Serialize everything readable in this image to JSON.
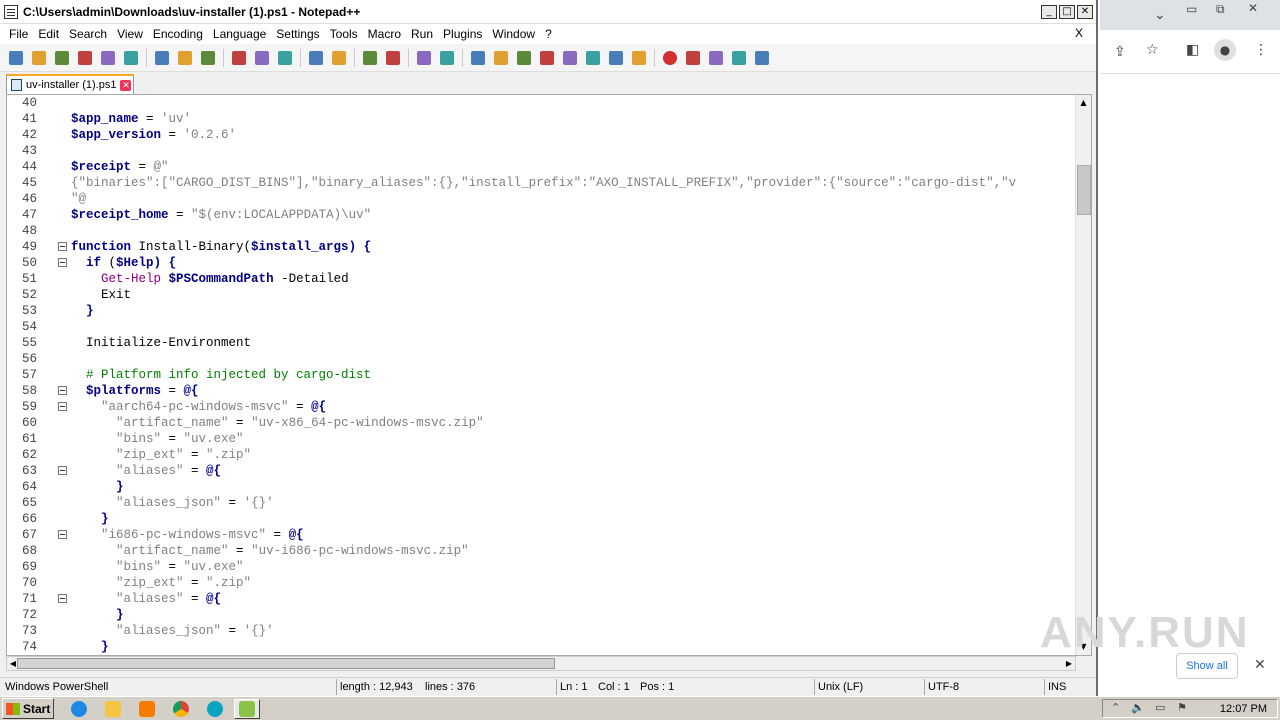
{
  "window": {
    "title": "C:\\Users\\admin\\Downloads\\uv-installer (1).ps1 - Notepad++"
  },
  "menu": [
    "File",
    "Edit",
    "Search",
    "View",
    "Encoding",
    "Language",
    "Settings",
    "Tools",
    "Macro",
    "Run",
    "Plugins",
    "Window",
    "?"
  ],
  "menu_close": "X",
  "tab": {
    "label": "uv-installer (1).ps1"
  },
  "colors": {
    "keyword": "#00008b",
    "string": "#808080",
    "comment": "#008000",
    "command": "#8b008b"
  },
  "toolbar_icons": [
    "new-icon",
    "open-icon",
    "save-icon",
    "save-all-icon",
    "close-icon",
    "close-all-icon",
    "print-icon",
    "cut-icon",
    "copy-icon",
    "paste-icon",
    "undo-icon",
    "redo-icon",
    "find-icon",
    "replace-icon",
    "zoom-in-icon",
    "zoom-out-icon",
    "sync-v-icon",
    "sync-h-icon",
    "wrap-icon",
    "all-chars-icon",
    "indent-guide-icon",
    "udl-icon",
    "doc-map-icon",
    "function-list-icon",
    "folder-icon",
    "monitor-icon",
    "record-icon",
    "stop-icon",
    "play-icon",
    "play-multi-icon",
    "save-macro-icon"
  ],
  "code_lines": [
    {
      "n": "40",
      "fold": false,
      "seg": []
    },
    {
      "n": "41",
      "fold": false,
      "seg": [
        {
          "t": "$app_name",
          "c": "var"
        },
        {
          "t": " = ",
          "c": ""
        },
        {
          "t": "'uv'",
          "c": "str"
        }
      ]
    },
    {
      "n": "42",
      "fold": false,
      "seg": [
        {
          "t": "$app_version",
          "c": "var"
        },
        {
          "t": " = ",
          "c": ""
        },
        {
          "t": "'0.2.6'",
          "c": "str"
        }
      ]
    },
    {
      "n": "43",
      "fold": false,
      "seg": []
    },
    {
      "n": "44",
      "fold": false,
      "seg": [
        {
          "t": "$receipt",
          "c": "var"
        },
        {
          "t": " = ",
          "c": ""
        },
        {
          "t": "@\"",
          "c": "str"
        }
      ]
    },
    {
      "n": "45",
      "fold": false,
      "seg": [
        {
          "t": "{\"binaries\":[\"CARGO_DIST_BINS\"],\"binary_aliases\":{},\"install_prefix\":\"AXO_INSTALL_PREFIX\",\"provider\":{\"source\":\"cargo-dist\",\"v",
          "c": "str"
        }
      ]
    },
    {
      "n": "46",
      "fold": false,
      "seg": [
        {
          "t": "\"@",
          "c": "str"
        }
      ]
    },
    {
      "n": "47",
      "fold": false,
      "seg": [
        {
          "t": "$receipt_home",
          "c": "var"
        },
        {
          "t": " = ",
          "c": ""
        },
        {
          "t": "\"$(env:LOCALAPPDATA)\\uv\"",
          "c": "str"
        }
      ]
    },
    {
      "n": "48",
      "fold": false,
      "seg": []
    },
    {
      "n": "49",
      "fold": true,
      "seg": [
        {
          "t": "function",
          "c": "kw"
        },
        {
          "t": " Install-Binary(",
          "c": ""
        },
        {
          "t": "$install_args",
          "c": "var"
        },
        {
          "t": ") {",
          "c": "kw"
        }
      ]
    },
    {
      "n": "50",
      "fold": true,
      "seg": [
        {
          "t": "  ",
          "c": ""
        },
        {
          "t": "if",
          "c": "kw"
        },
        {
          "t": " (",
          "c": ""
        },
        {
          "t": "$Help",
          "c": "var"
        },
        {
          "t": ") {",
          "c": "kw"
        }
      ]
    },
    {
      "n": "51",
      "fold": false,
      "seg": [
        {
          "t": "    ",
          "c": ""
        },
        {
          "t": "Get-Help",
          "c": "cmd"
        },
        {
          "t": " ",
          "c": ""
        },
        {
          "t": "$PSCommandPath",
          "c": "var"
        },
        {
          "t": " -Detailed",
          "c": ""
        }
      ]
    },
    {
      "n": "52",
      "fold": false,
      "seg": [
        {
          "t": "    Exit",
          "c": ""
        }
      ]
    },
    {
      "n": "53",
      "fold": false,
      "seg": [
        {
          "t": "  }",
          "c": "kw"
        }
      ]
    },
    {
      "n": "54",
      "fold": false,
      "seg": []
    },
    {
      "n": "55",
      "fold": false,
      "seg": [
        {
          "t": "  Initialize-Environment",
          "c": ""
        }
      ]
    },
    {
      "n": "56",
      "fold": false,
      "seg": []
    },
    {
      "n": "57",
      "fold": false,
      "seg": [
        {
          "t": "  # Platform info injected by cargo-dist",
          "c": "cmt"
        }
      ]
    },
    {
      "n": "58",
      "fold": true,
      "seg": [
        {
          "t": "  ",
          "c": ""
        },
        {
          "t": "$platforms",
          "c": "var"
        },
        {
          "t": " = ",
          "c": ""
        },
        {
          "t": "@{",
          "c": "kw"
        }
      ]
    },
    {
      "n": "59",
      "fold": true,
      "seg": [
        {
          "t": "    ",
          "c": ""
        },
        {
          "t": "\"aarch64-pc-windows-msvc\"",
          "c": "str"
        },
        {
          "t": " = ",
          "c": ""
        },
        {
          "t": "@{",
          "c": "kw"
        }
      ]
    },
    {
      "n": "60",
      "fold": false,
      "seg": [
        {
          "t": "      ",
          "c": ""
        },
        {
          "t": "\"artifact_name\"",
          "c": "str"
        },
        {
          "t": " = ",
          "c": ""
        },
        {
          "t": "\"uv-x86_64-pc-windows-msvc.zip\"",
          "c": "str"
        }
      ]
    },
    {
      "n": "61",
      "fold": false,
      "seg": [
        {
          "t": "      ",
          "c": ""
        },
        {
          "t": "\"bins\"",
          "c": "str"
        },
        {
          "t": " = ",
          "c": ""
        },
        {
          "t": "\"uv.exe\"",
          "c": "str"
        }
      ]
    },
    {
      "n": "62",
      "fold": false,
      "seg": [
        {
          "t": "      ",
          "c": ""
        },
        {
          "t": "\"zip_ext\"",
          "c": "str"
        },
        {
          "t": " = ",
          "c": ""
        },
        {
          "t": "\".zip\"",
          "c": "str"
        }
      ]
    },
    {
      "n": "63",
      "fold": true,
      "seg": [
        {
          "t": "      ",
          "c": ""
        },
        {
          "t": "\"aliases\"",
          "c": "str"
        },
        {
          "t": " = ",
          "c": ""
        },
        {
          "t": "@{",
          "c": "kw"
        }
      ]
    },
    {
      "n": "64",
      "fold": false,
      "seg": [
        {
          "t": "      }",
          "c": "kw"
        }
      ]
    },
    {
      "n": "65",
      "fold": false,
      "seg": [
        {
          "t": "      ",
          "c": ""
        },
        {
          "t": "\"aliases_json\"",
          "c": "str"
        },
        {
          "t": " = ",
          "c": ""
        },
        {
          "t": "'{}'",
          "c": "str"
        }
      ]
    },
    {
      "n": "66",
      "fold": false,
      "seg": [
        {
          "t": "    }",
          "c": "kw"
        }
      ]
    },
    {
      "n": "67",
      "fold": true,
      "seg": [
        {
          "t": "    ",
          "c": ""
        },
        {
          "t": "\"i686-pc-windows-msvc\"",
          "c": "str"
        },
        {
          "t": " = ",
          "c": ""
        },
        {
          "t": "@{",
          "c": "kw"
        }
      ]
    },
    {
      "n": "68",
      "fold": false,
      "seg": [
        {
          "t": "      ",
          "c": ""
        },
        {
          "t": "\"artifact_name\"",
          "c": "str"
        },
        {
          "t": " = ",
          "c": ""
        },
        {
          "t": "\"uv-i686-pc-windows-msvc.zip\"",
          "c": "str"
        }
      ]
    },
    {
      "n": "69",
      "fold": false,
      "seg": [
        {
          "t": "      ",
          "c": ""
        },
        {
          "t": "\"bins\"",
          "c": "str"
        },
        {
          "t": " = ",
          "c": ""
        },
        {
          "t": "\"uv.exe\"",
          "c": "str"
        }
      ]
    },
    {
      "n": "70",
      "fold": false,
      "seg": [
        {
          "t": "      ",
          "c": ""
        },
        {
          "t": "\"zip_ext\"",
          "c": "str"
        },
        {
          "t": " = ",
          "c": ""
        },
        {
          "t": "\".zip\"",
          "c": "str"
        }
      ]
    },
    {
      "n": "71",
      "fold": true,
      "seg": [
        {
          "t": "      ",
          "c": ""
        },
        {
          "t": "\"aliases\"",
          "c": "str"
        },
        {
          "t": " = ",
          "c": ""
        },
        {
          "t": "@{",
          "c": "kw"
        }
      ]
    },
    {
      "n": "72",
      "fold": false,
      "seg": [
        {
          "t": "      }",
          "c": "kw"
        }
      ]
    },
    {
      "n": "73",
      "fold": false,
      "seg": [
        {
          "t": "      ",
          "c": ""
        },
        {
          "t": "\"aliases_json\"",
          "c": "str"
        },
        {
          "t": " = ",
          "c": ""
        },
        {
          "t": "'{}'",
          "c": "str"
        }
      ]
    },
    {
      "n": "74",
      "fold": false,
      "seg": [
        {
          "t": "    }",
          "c": "kw"
        }
      ]
    }
  ],
  "status": {
    "language": "Windows PowerShell",
    "length": "length : 12,943",
    "lines": "lines : 376",
    "ln": "Ln : 1",
    "col": "Col : 1",
    "pos": "Pos : 1",
    "eol": "Unix (LF)",
    "encoding": "UTF-8",
    "mode": "INS"
  },
  "browser": {
    "show_all": "Show all",
    "close": "✕",
    "watermark": "ANY.RUN"
  },
  "taskbar": {
    "start": "Start",
    "clock": "12:07 PM"
  }
}
